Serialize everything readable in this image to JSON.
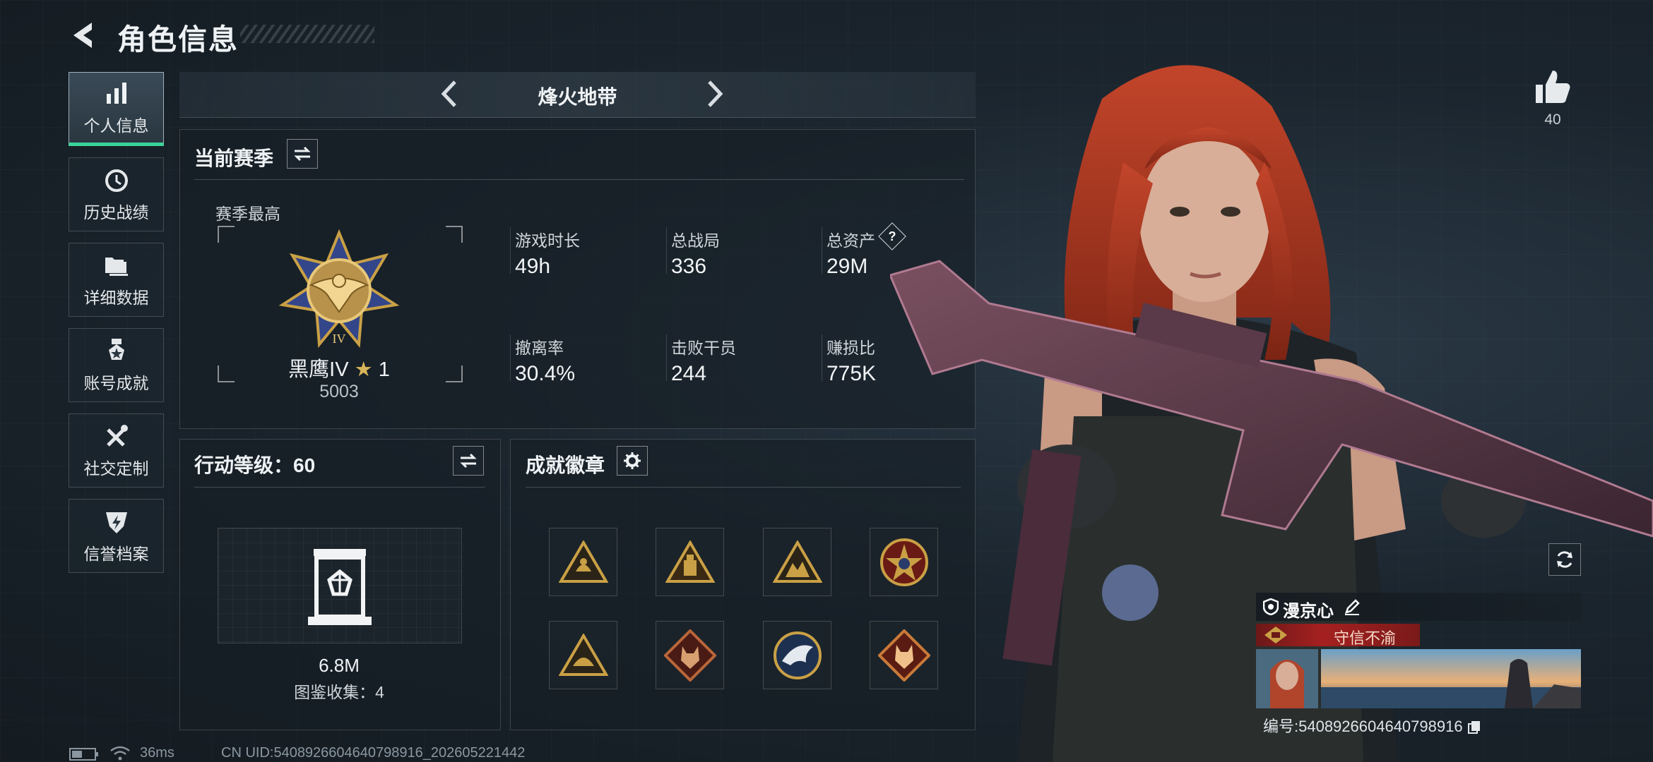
{
  "header": {
    "title": "角色信息"
  },
  "sidebar": {
    "items": [
      {
        "label": "个人信息",
        "icon": "bar-chart-icon",
        "active": true
      },
      {
        "label": "历史战绩",
        "icon": "history-clock-icon",
        "active": false
      },
      {
        "label": "详细数据",
        "icon": "folders-icon",
        "active": false
      },
      {
        "label": "账号成就",
        "icon": "medal-star-icon",
        "active": false
      },
      {
        "label": "社交定制",
        "icon": "tools-icon",
        "active": false
      },
      {
        "label": "信誉档案",
        "icon": "shield-lightning-icon",
        "active": false
      }
    ]
  },
  "season_bar": {
    "name": "烽火地带"
  },
  "current_season": {
    "title": "当前赛季",
    "season_best_label": "赛季最高",
    "rank_name": "黑鹰IV",
    "rank_stars": "1",
    "rank_points": "5003",
    "stats": [
      {
        "label": "游戏时长",
        "value": "49h"
      },
      {
        "label": "总战局",
        "value": "336"
      },
      {
        "label": "总资产",
        "value": "29M",
        "help": "?"
      },
      {
        "label": "撤离率",
        "value": "30.4%"
      },
      {
        "label": "击败干员",
        "value": "244"
      },
      {
        "label": "赚损比",
        "value": "775K"
      }
    ]
  },
  "action_level": {
    "title": "行动等级：60",
    "value": "6.8M",
    "collection": "图鉴收集：4"
  },
  "achievements": {
    "title": "成就徽章",
    "badges": [
      "triangle-badge-icon",
      "triangle-badge-icon",
      "triangle-badge-icon",
      "star-round-badge-icon",
      "triangle-badge-icon",
      "diamond-wolf-badge-icon",
      "eagle-round-badge-icon",
      "diamond-wolf-badge-icon"
    ]
  },
  "likes": {
    "count": "40"
  },
  "player_card": {
    "name": "漫京心",
    "motto": "守信不渝",
    "id_text": "编号:5408926604640798916"
  },
  "status_bar": {
    "ping": "36ms",
    "uid": "CN UID:5408926604640798916_202605221442"
  },
  "colors": {
    "accent_green": "#39d39a",
    "motto_red": "#a52020",
    "gold": "#c9a045"
  }
}
